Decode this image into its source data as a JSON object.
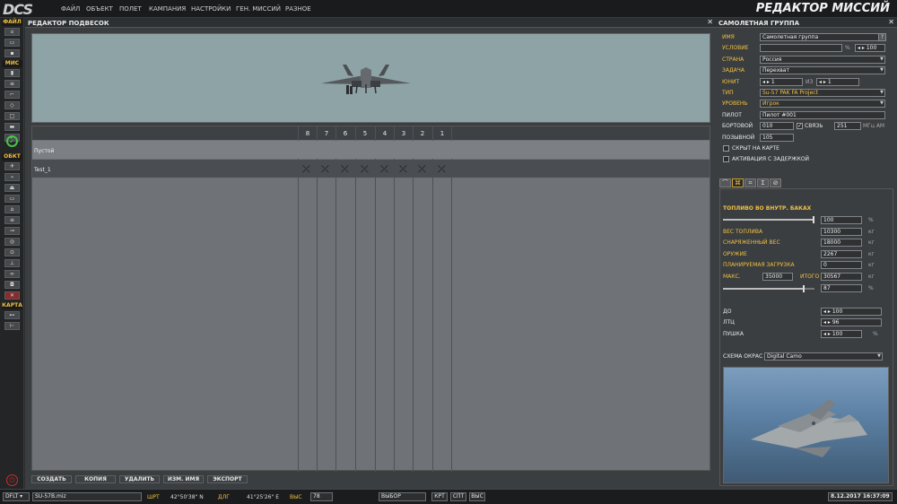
{
  "menubar": {
    "logo": "DCS",
    "items": [
      "ФАЙЛ",
      "ОБЪЕКТ",
      "ПОЛЕТ",
      "КАМПАНИЯ",
      "НАСТРОЙКИ",
      "ГЕН. МИССИЙ",
      "РАЗНОЕ"
    ],
    "title": "РЕДАКТОР МИССИЙ"
  },
  "toolbar": {
    "sections": [
      "ФАЙЛ",
      "МИС",
      "ОБКТ",
      "КАРТА"
    ]
  },
  "payload": {
    "title": "РЕДАКТОР ПОДВЕСОК",
    "pylons": [
      "8",
      "7",
      "6",
      "5",
      "4",
      "3",
      "2",
      "1"
    ],
    "rows": [
      {
        "name": "Пустой",
        "loadout": [
          "",
          "",
          "",
          "",
          "",
          "",
          "",
          ""
        ]
      },
      {
        "name": "Test_1",
        "loadout": [
          "x",
          "x",
          "x",
          "x",
          "x",
          "x",
          "x",
          "x"
        ]
      }
    ],
    "buttons": {
      "create": "СОЗДАТЬ",
      "copy": "КОПИЯ",
      "delete": "УДАЛИТЬ",
      "rename": "ИЗМ. ИМЯ",
      "export": "ЭКСПОРТ"
    }
  },
  "group": {
    "title": "САМОЛЕТНАЯ ГРУППА",
    "help": "?",
    "labels": {
      "name": "ИМЯ",
      "condition": "УСЛОВИЕ",
      "country": "СТРАНА",
      "task": "ЗАДАЧА",
      "unit": "ЮНИТ",
      "type": "ТИП",
      "level": "УРОВЕНЬ",
      "pilot": "ПИЛОТ",
      "tail": "БОРТОВОЙ",
      "comm": "СВЯЗЬ",
      "callsign": "ПОЗЫВНОЙ",
      "hidden": "СКРЫТ НА КАРТЕ",
      "late": "АКТИВАЦИЯ С ЗАДЕРЖКОЙ",
      "of": "ИЗ"
    },
    "values": {
      "name": "Самолетная группа",
      "condition": "",
      "condition_pct": "%",
      "condition_value": "100",
      "country": "Россия",
      "task": "Перехват",
      "unit": "1",
      "unit_of": "1",
      "type": "Su-57 PAK FA Project",
      "level": "Игрок",
      "pilot": "Пилот #001",
      "tail": "010",
      "freq": "251",
      "freq_unit": "МГц AM",
      "callsign": "105"
    }
  },
  "loadout": {
    "tabs": [
      "route-icon",
      "payload-icon",
      "waypoint-icon",
      "summary-icon",
      "cancel-icon"
    ],
    "internal_fuel_title": "ТОПЛИВО ВО ВНУТР. БАКАХ",
    "fuel_pct": "100",
    "fuel_level": 1.0,
    "weight_level": 0.87,
    "rows": [
      {
        "label": "ВЕС ТОПЛИВА",
        "value": "10300",
        "unit": "кг"
      },
      {
        "label": "СНАРЯЖЕННЫЙ ВЕС",
        "value": "18000",
        "unit": "кг"
      },
      {
        "label": "ОРУЖИЕ",
        "value": "2267",
        "unit": "кг"
      },
      {
        "label": "ПЛАНИРУЕМАЯ ЗАГРУЗКА",
        "value": "0",
        "unit": "кг"
      }
    ],
    "max_label": "МАКС.",
    "max_value": "35000",
    "total_label": "ИТОГО",
    "total_value": "30567",
    "total_unit": "кг",
    "total_pct": "87",
    "pct": "%",
    "chaff_label": "ДО",
    "chaff": "100",
    "flare_label": "ЛТЦ",
    "flare": "96",
    "gun_label": "ПУШКА",
    "gun": "100",
    "livery_label": "СХЕМА ОКРАС",
    "livery": "Digital Camo"
  },
  "statusbar": {
    "mode": "DFLT",
    "file": "SU-57B.miz",
    "lat_label": "ШРТ",
    "lat": "42°50'38\" N",
    "lon_label": "ДЛГ",
    "lon": "41°25'26\" E",
    "alt_label": "ВЫС",
    "alt": "78",
    "select": "ВЫБОР",
    "btn_map": "КРТ",
    "btn_sat": "СПТ",
    "btn_alt": "ВЫС",
    "datetime": "8.12.2017 16:37:09"
  },
  "colors": {
    "accent": "#f0c040",
    "panel": "#3b3e41",
    "sky": "#8ea3a6"
  }
}
